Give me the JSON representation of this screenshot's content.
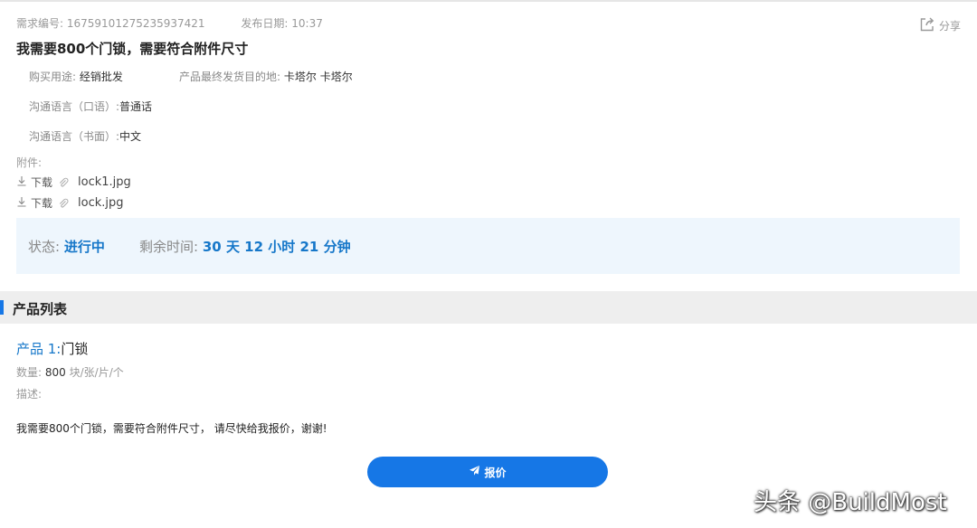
{
  "header": {
    "req_no_label": "需求编号:",
    "req_no": "16759101275235937421",
    "date_label": "发布日期:",
    "date": "10:37",
    "share_label": "分享"
  },
  "title": "我需要800个门锁，需要符合附件尺寸",
  "info": {
    "purpose_label": "购买用途:",
    "purpose": "经销批发",
    "destination_label": "产品最终发货目的地:",
    "destination": "卡塔尔 卡塔尔",
    "spoken_lang_label": "沟通语言（口语）:",
    "spoken_lang": "普通话",
    "written_lang_label": "沟通语言（书面）:",
    "written_lang": "中文"
  },
  "attachments": {
    "label": "附件:",
    "download_label": "下载",
    "files": [
      "lock1.jpg",
      "lock.jpg"
    ]
  },
  "status": {
    "status_label": "状态:",
    "status": "进行中",
    "remaining_label": "剩余时间:",
    "remaining": "30 天 12 小时 21 分钟"
  },
  "product_list": {
    "heading": "产品列表",
    "product_label": "产品 1:",
    "product_name": "门锁",
    "qty_label": "数量:",
    "qty": "800",
    "qty_unit": "块/张/片/个",
    "desc_label": "描述:",
    "desc": "我需要800个门锁，需要符合附件尺寸，  请尽快给我报价，谢谢!"
  },
  "quote_button": "报价",
  "watermark": "头条 @BuildMost",
  "colors": {
    "accent": "#1677e6",
    "status_text": "#1677c9",
    "status_bg": "#eef6fd",
    "section_bg": "#eeeeee"
  }
}
